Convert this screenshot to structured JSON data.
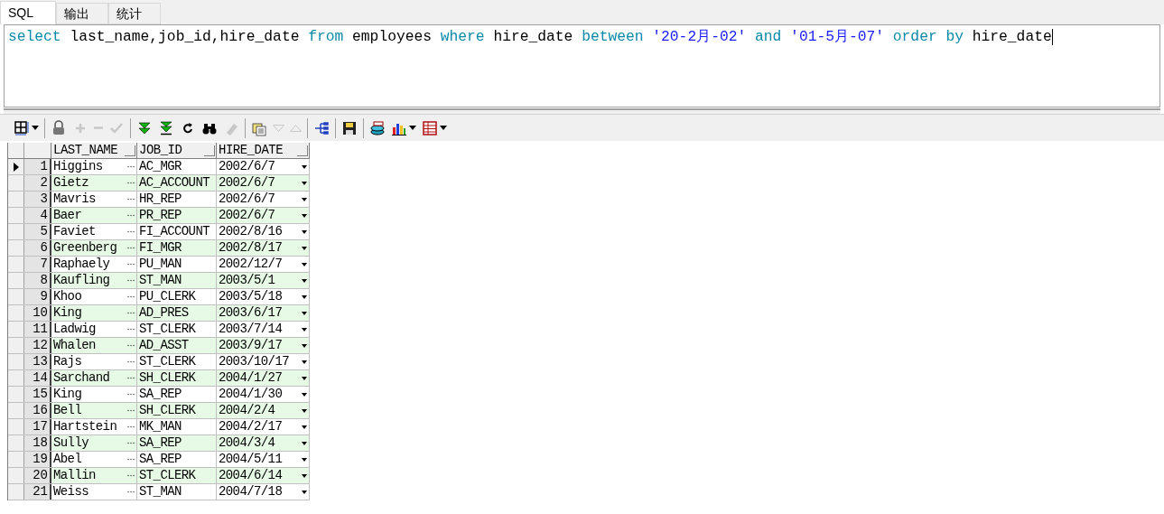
{
  "tabs": [
    {
      "label": "SQL",
      "selected": true
    },
    {
      "label": "输出",
      "selected": false
    },
    {
      "label": "统计",
      "selected": false
    }
  ],
  "editor": {
    "tokens": [
      {
        "text": "select",
        "kind": "keyword"
      },
      {
        "text": " last_name,job_id,hire_date ",
        "kind": "plain"
      },
      {
        "text": "from",
        "kind": "keyword"
      },
      {
        "text": " employees ",
        "kind": "plain"
      },
      {
        "text": "where",
        "kind": "keyword"
      },
      {
        "text": " hire_date ",
        "kind": "plain"
      },
      {
        "text": "between ",
        "kind": "keyword"
      },
      {
        "text": "'20-2月-02' ",
        "kind": "string"
      },
      {
        "text": "and ",
        "kind": "keyword"
      },
      {
        "text": "'01-5月-07' ",
        "kind": "string"
      },
      {
        "text": "order by",
        "kind": "keyword"
      },
      {
        "text": " hire_date",
        "kind": "plain"
      }
    ]
  },
  "toolbar": [
    {
      "kind": "grid",
      "disabled": false,
      "dropdown": true
    },
    {
      "kind": "lock",
      "disabled": false,
      "dropdown": false
    },
    {
      "kind": "add",
      "disabled": true,
      "dropdown": false
    },
    {
      "kind": "remove",
      "disabled": true,
      "dropdown": false
    },
    {
      "kind": "check",
      "disabled": true,
      "dropdown": false
    },
    {
      "kind": "next",
      "disabled": false,
      "dropdown": false
    },
    {
      "kind": "last",
      "disabled": false,
      "dropdown": false
    },
    {
      "kind": "refresh",
      "disabled": false,
      "dropdown": false
    },
    {
      "kind": "find",
      "disabled": false,
      "dropdown": false
    },
    {
      "kind": "eraser",
      "disabled": true,
      "dropdown": false
    },
    {
      "kind": "copy",
      "disabled": false,
      "dropdown": false
    },
    {
      "kind": "down",
      "disabled": true,
      "dropdown": false
    },
    {
      "kind": "up",
      "disabled": true,
      "dropdown": false
    },
    {
      "kind": "tree",
      "disabled": false,
      "dropdown": false
    },
    {
      "kind": "save",
      "disabled": false,
      "dropdown": false
    },
    {
      "kind": "export",
      "disabled": false,
      "dropdown": false
    },
    {
      "kind": "chart",
      "disabled": false,
      "dropdown": true
    },
    {
      "kind": "table",
      "disabled": false,
      "dropdown": true
    }
  ],
  "grid": {
    "columns": [
      "LAST_NAME",
      "JOB_ID",
      "HIRE_DATE"
    ],
    "rows": [
      {
        "num": "1",
        "cells": [
          "Higgins",
          "AC_MGR",
          "2002/6/7"
        ],
        "selected": true
      },
      {
        "num": "2",
        "cells": [
          "Gietz",
          "AC_ACCOUNT",
          "2002/6/7"
        ],
        "selected": false
      },
      {
        "num": "3",
        "cells": [
          "Mavris",
          "HR_REP",
          "2002/6/7"
        ],
        "selected": false
      },
      {
        "num": "4",
        "cells": [
          "Baer",
          "PR_REP",
          "2002/6/7"
        ],
        "selected": false
      },
      {
        "num": "5",
        "cells": [
          "Faviet",
          "FI_ACCOUNT",
          "2002/8/16"
        ],
        "selected": false
      },
      {
        "num": "6",
        "cells": [
          "Greenberg",
          "FI_MGR",
          "2002/8/17"
        ],
        "selected": false
      },
      {
        "num": "7",
        "cells": [
          "Raphaely",
          "PU_MAN",
          "2002/12/7"
        ],
        "selected": false
      },
      {
        "num": "8",
        "cells": [
          "Kaufling",
          "ST_MAN",
          "2003/5/1"
        ],
        "selected": false
      },
      {
        "num": "9",
        "cells": [
          "Khoo",
          "PU_CLERK",
          "2003/5/18"
        ],
        "selected": false
      },
      {
        "num": "10",
        "cells": [
          "King",
          "AD_PRES",
          "2003/6/17"
        ],
        "selected": false
      },
      {
        "num": "11",
        "cells": [
          "Ladwig",
          "ST_CLERK",
          "2003/7/14"
        ],
        "selected": false
      },
      {
        "num": "12",
        "cells": [
          "Whalen",
          "AD_ASST",
          "2003/9/17"
        ],
        "selected": false
      },
      {
        "num": "13",
        "cells": [
          "Rajs",
          "ST_CLERK",
          "2003/10/17"
        ],
        "selected": false
      },
      {
        "num": "14",
        "cells": [
          "Sarchand",
          "SH_CLERK",
          "2004/1/27"
        ],
        "selected": false
      },
      {
        "num": "15",
        "cells": [
          "King",
          "SA_REP",
          "2004/1/30"
        ],
        "selected": false
      },
      {
        "num": "16",
        "cells": [
          "Bell",
          "SH_CLERK",
          "2004/2/4"
        ],
        "selected": false
      },
      {
        "num": "17",
        "cells": [
          "Hartstein",
          "MK_MAN",
          "2004/2/17"
        ],
        "selected": false
      },
      {
        "num": "18",
        "cells": [
          "Sully",
          "SA_REP",
          "2004/3/4"
        ],
        "selected": false
      },
      {
        "num": "19",
        "cells": [
          "Abel",
          "SA_REP",
          "2004/5/11"
        ],
        "selected": false
      },
      {
        "num": "20",
        "cells": [
          "Mallin",
          "ST_CLERK",
          "2004/6/14"
        ],
        "selected": false
      },
      {
        "num": "21",
        "cells": [
          "Weiss",
          "ST_MAN",
          "2004/7/18"
        ],
        "selected": false
      }
    ]
  }
}
